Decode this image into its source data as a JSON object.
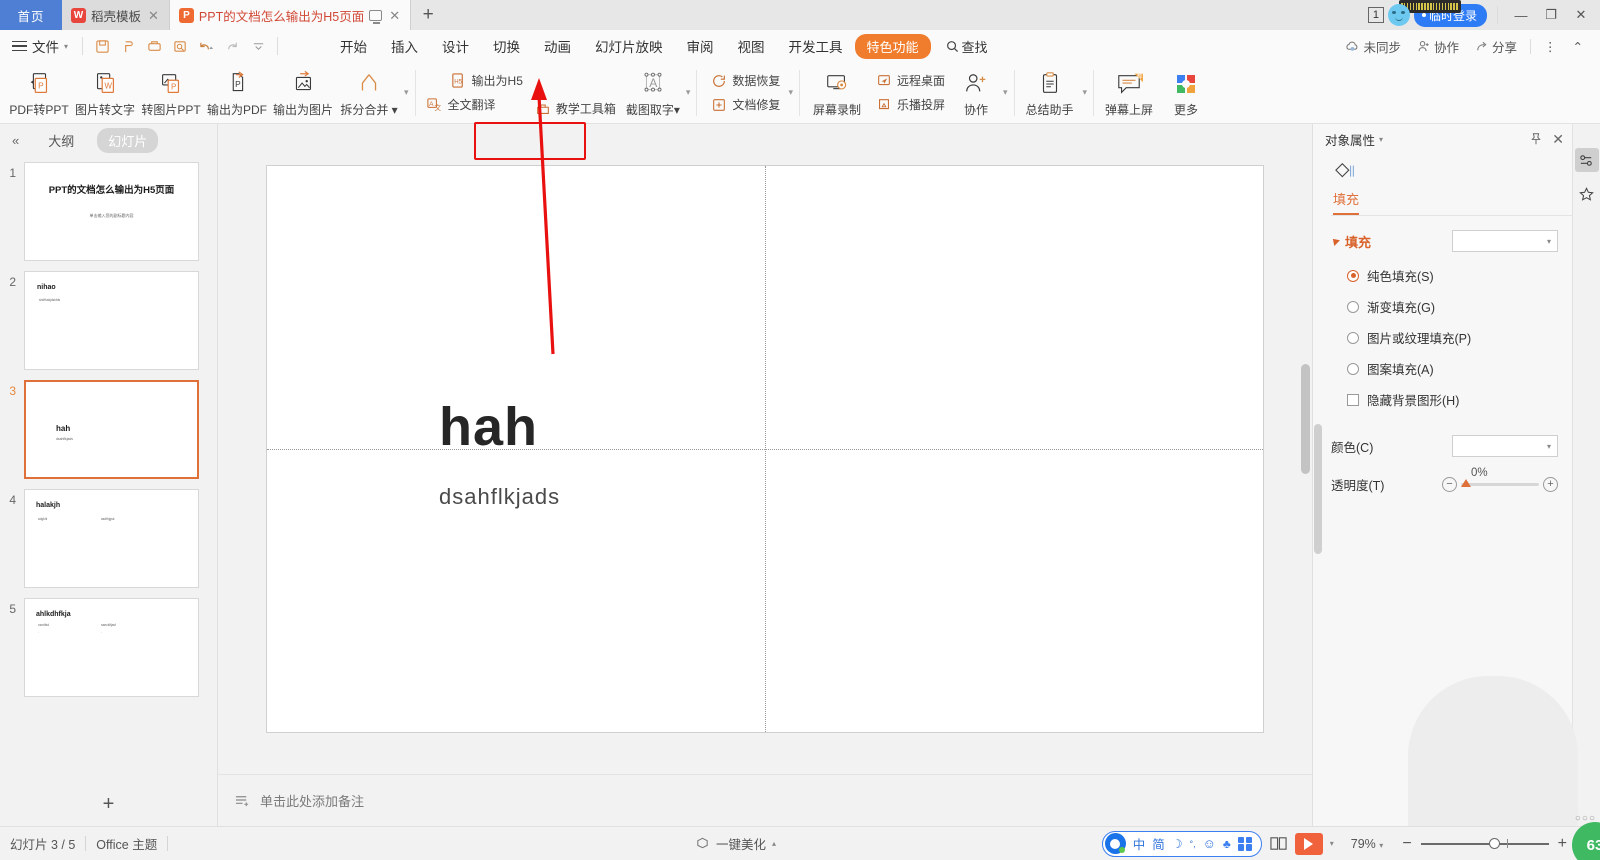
{
  "window": {
    "home_tab": "首页",
    "tabs": [
      {
        "label": "稻壳模板",
        "icon": "daoke-icon",
        "active": false
      },
      {
        "label": "PPT的文档怎么输出为H5页面",
        "icon": "ppt-icon",
        "active": true
      }
    ],
    "new_tab": "+",
    "notify_count": "1",
    "login_label": "临时登录",
    "minimize": "—",
    "maximize": "❐",
    "close": "✕"
  },
  "menubar": {
    "file_label": "文件",
    "quick_access": [
      "save-icon",
      "print-preview-icon",
      "print-icon",
      "find-icon",
      "undo-icon",
      "redo-icon",
      "customize-icon"
    ],
    "items": [
      {
        "label": "开始"
      },
      {
        "label": "插入"
      },
      {
        "label": "设计"
      },
      {
        "label": "切换"
      },
      {
        "label": "动画"
      },
      {
        "label": "幻灯片放映"
      },
      {
        "label": "审阅"
      },
      {
        "label": "视图"
      },
      {
        "label": "开发工具"
      },
      {
        "label": "特色功能",
        "highlight": true
      }
    ],
    "find_label": "查找",
    "right_items": [
      {
        "label": "未同步",
        "icon": "cloud-sync-icon"
      },
      {
        "label": "协作",
        "icon": "collaborate-icon"
      },
      {
        "label": "分享",
        "icon": "share-icon"
      }
    ],
    "more_menu": "⋮",
    "collapse_ribbon": "⌃"
  },
  "ribbon": {
    "items": [
      {
        "label": "PDF转PPT",
        "icon": "pdf-to-ppt-icon"
      },
      {
        "label": "图片转文字",
        "icon": "image-to-text-icon"
      },
      {
        "label": "转图片PPT",
        "icon": "to-image-ppt-icon"
      },
      {
        "label": "输出为PDF",
        "icon": "export-pdf-icon"
      },
      {
        "label": "输出为图片",
        "icon": "export-image-icon"
      },
      {
        "label": "拆分合并",
        "icon": "split-merge-icon",
        "dropdown": true
      }
    ],
    "group_translate": {
      "top_label": "输出为H5",
      "bottom_label": "全文翻译",
      "top_icon": "export-h5-icon",
      "bottom_icon": "translate-icon",
      "highlighted": true
    },
    "group_edu": {
      "label": "教学工具箱",
      "icon": "edu-toolbox-icon"
    },
    "group_capture": {
      "label": "截图取字",
      "icon": "screen-capture-text-icon",
      "dropdown": true
    },
    "group_recovery": {
      "rows": [
        {
          "label": "数据恢复",
          "icon": "data-recovery-icon"
        },
        {
          "label": "文档修复",
          "icon": "doc-repair-icon"
        }
      ]
    },
    "group_record": {
      "label": "屏幕录制",
      "icon": "screen-record-icon"
    },
    "group_remote": {
      "rows": [
        {
          "label": "远程桌面",
          "icon": "remote-desktop-icon"
        },
        {
          "label": "乐播投屏",
          "icon": "cast-screen-icon"
        }
      ]
    },
    "group_collab": {
      "label": "协作",
      "icon": "collab-user-icon",
      "dropdown": true
    },
    "group_summary": {
      "label": "总结助手",
      "icon": "summary-assistant-icon",
      "dropdown": true
    },
    "group_danmu": {
      "label": "弹幕上屏",
      "icon": "danmu-icon",
      "badge": "荐"
    },
    "group_more": {
      "label": "更多",
      "icon": "more-apps-icon"
    }
  },
  "left_panel": {
    "collapse_icon": "collapse-left-icon",
    "tabs": [
      {
        "label": "大纲",
        "active": false
      },
      {
        "label": "幻灯片",
        "active": true
      }
    ],
    "slides": [
      {
        "num": "1",
        "title": "PPT的文档怎么输出为H5页面",
        "subtitle": "单击输入您的副标题内容",
        "layout": "title",
        "selected": false
      },
      {
        "num": "2",
        "title": "nihao",
        "subtitle": "shdfhakjdskfds",
        "layout": "content",
        "selected": false
      },
      {
        "num": "3",
        "title": "hah",
        "subtitle": "dsahflkjads",
        "layout": "content",
        "selected": true
      },
      {
        "num": "4",
        "title": "halakjh",
        "subtitle": "sdgkhl",
        "subtitle2": "asdfhjgsk",
        "layout": "two-col",
        "selected": false
      },
      {
        "num": "5",
        "title": "ahlkdhfkja",
        "subtitle": "csedfsd",
        "subtitle2": "saecklfjasf",
        "layout": "two-col-2",
        "selected": false
      }
    ],
    "add_slide": "+"
  },
  "slide": {
    "heading": "hah",
    "body": "dsahflkjads"
  },
  "notes": {
    "icon": "notes-icon",
    "placeholder": "单击此处添加备注"
  },
  "right_panel": {
    "title": "对象属性",
    "pin_icon": "pin-icon",
    "close_icon": "close-icon",
    "tab_icon": "shape-fill-icon",
    "tab_label": "填充",
    "section_title": "填充",
    "fill_combo_value": "",
    "options": [
      {
        "label": "纯色填充(S)",
        "selected": true
      },
      {
        "label": "渐变填充(G)",
        "selected": false
      },
      {
        "label": "图片或纹理填充(P)",
        "selected": false
      },
      {
        "label": "图案填充(A)",
        "selected": false
      }
    ],
    "checkbox": {
      "label": "隐藏背景图形(H)",
      "checked": false
    },
    "color_label": "颜色(C)",
    "color_value": "",
    "transparency_label": "透明度(T)",
    "transparency_value": "0%",
    "accent_color": "#d9622b"
  },
  "rail": {
    "buttons": [
      {
        "icon": "properties-sliders-icon",
        "active": true
      },
      {
        "icon": "magic-star-icon",
        "active": false
      }
    ]
  },
  "statusbar": {
    "slide_count": "幻灯片 3 / 5",
    "theme": "Office 主题",
    "beautify": "一键美化",
    "beautify_icon": "beautify-icon",
    "ime": {
      "lang": "中",
      "mode": "简",
      "moon_icon": "moon-icon",
      "punct_icon": "punctuation-icon",
      "emoji_icon": "emoji-icon",
      "clothes_icon": "skin-icon",
      "apps_icon": "apps-grid-icon"
    },
    "reading_view_icon": "reading-view-icon",
    "play_icon": "play-icon",
    "zoom_level": "79%",
    "zoom_out": "−",
    "zoom_in": "+",
    "fit_icon": "fit-to-window-icon",
    "float_badge": "63"
  },
  "annotation": {
    "arrow_color": "#e8110f",
    "highlight_color": "#e8110f"
  }
}
